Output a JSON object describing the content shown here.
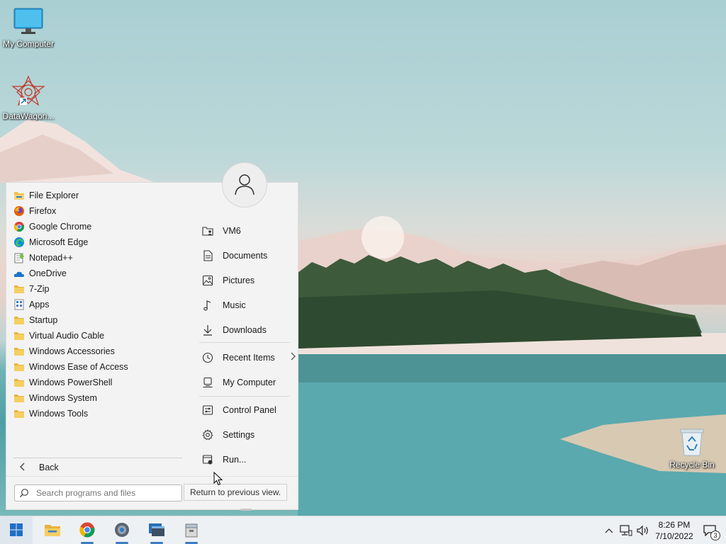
{
  "desktop": {
    "icons": [
      {
        "label": "My Computer",
        "icon": "monitor-icon"
      },
      {
        "label": "DataWagon...",
        "icon": "datawagon-logo-icon"
      }
    ],
    "recycle_bin": {
      "label": "Recycle Bin",
      "icon": "recycle-bin-icon"
    }
  },
  "start_menu": {
    "programs": [
      {
        "label": "File Explorer",
        "icon": "folder-explorer-icon"
      },
      {
        "label": "Firefox",
        "icon": "firefox-icon"
      },
      {
        "label": "Google Chrome",
        "icon": "chrome-icon"
      },
      {
        "label": "Microsoft Edge",
        "icon": "edge-icon"
      },
      {
        "label": "Notepad++",
        "icon": "notepadpp-icon"
      },
      {
        "label": "OneDrive",
        "icon": "onedrive-icon"
      },
      {
        "label": "7-Zip",
        "icon": "folder-icon"
      },
      {
        "label": "Apps",
        "icon": "apps-icon"
      },
      {
        "label": "Startup",
        "icon": "folder-icon"
      },
      {
        "label": "Virtual Audio Cable",
        "icon": "folder-icon"
      },
      {
        "label": "Windows Accessories",
        "icon": "folder-icon"
      },
      {
        "label": "Windows Ease of Access",
        "icon": "folder-icon"
      },
      {
        "label": "Windows PowerShell",
        "icon": "folder-icon"
      },
      {
        "label": "Windows System",
        "icon": "folder-icon"
      },
      {
        "label": "Windows Tools",
        "icon": "folder-icon"
      }
    ],
    "back_label": "Back",
    "places": [
      {
        "label": "VM6",
        "icon": "user-folder-icon"
      },
      {
        "label": "Documents",
        "icon": "document-icon"
      },
      {
        "label": "Pictures",
        "icon": "picture-icon"
      },
      {
        "label": "Music",
        "icon": "music-icon"
      },
      {
        "label": "Downloads",
        "icon": "download-icon"
      },
      {
        "label": "Recent Items",
        "icon": "clock-icon"
      },
      {
        "label": "My Computer",
        "icon": "computer-icon"
      },
      {
        "label": "Control Panel",
        "icon": "control-panel-icon"
      },
      {
        "label": "Settings",
        "icon": "gear-icon"
      },
      {
        "label": "Run...",
        "icon": "run-icon"
      }
    ],
    "search": {
      "placeholder": "Search programs and files",
      "value": ""
    },
    "tooltip": "Return to previous view."
  },
  "taskbar": {
    "apps": [
      {
        "name": "start",
        "icon": "windows-logo-icon"
      },
      {
        "name": "file-explorer",
        "icon": "folder-icon"
      },
      {
        "name": "chrome",
        "icon": "chrome-icon"
      },
      {
        "name": "settings",
        "icon": "gear-icon"
      },
      {
        "name": "window-app",
        "icon": "window-icon"
      },
      {
        "name": "archive-app",
        "icon": "archive-icon"
      }
    ],
    "clock": {
      "time": "8:26 PM",
      "date": "7/10/2022"
    },
    "notification_count": "3"
  },
  "colors": {
    "accent": "#3e7cc4",
    "folder": "#f2c14e",
    "menu_bg": "#f3f3f3",
    "taskbar_bg": "#eef1f4"
  }
}
